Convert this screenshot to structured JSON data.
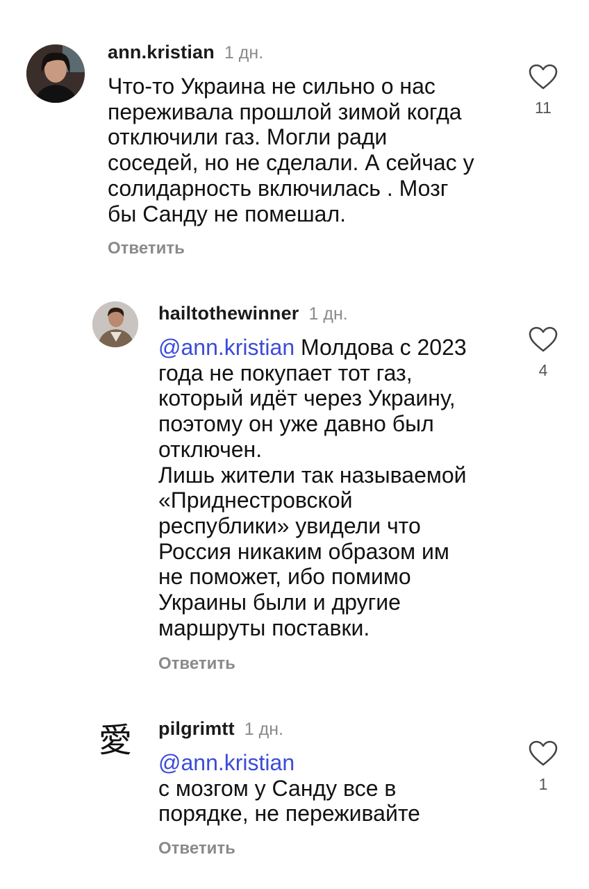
{
  "comments": [
    {
      "username": "ann.kristian",
      "time": "1 дн.",
      "text_lines": [
        "Что-то Украина не сильно о нас",
        "переживала прошлой зимой когда",
        "отключили газ. Могли ради",
        "соседей, но не сделали. А сейчас у",
        "солидарность включилась . Мозг",
        "бы Санду не помешал."
      ],
      "reply_label": "Ответить",
      "likes": "11",
      "like_icon": "heart-outline-icon"
    },
    {
      "username": "hailtothewinner",
      "time": "1 дн.",
      "mention": "@ann.kristian",
      "text_first_rest": " Молдова с 2023",
      "text_lines": [
        "года не покупает тот газ,",
        "который идёт через Украину,",
        "поэтому он уже давно был",
        "отключен.",
        "Лишь жители так называемой",
        "«Приднестровской",
        "республики» увидели что",
        "Россия никаким образом им",
        "не поможет, ибо помимо",
        "Украины были и другие",
        "маршруты поставки."
      ],
      "reply_label": "Ответить",
      "likes": "4",
      "like_icon": "heart-outline-icon"
    },
    {
      "username": "pilgrimtt",
      "time": "1 дн.",
      "mention": "@ann.kristian",
      "text_lines": [
        "с мозгом у Санду все в",
        "порядке, не переживайте"
      ],
      "reply_label": "Ответить",
      "likes": "1",
      "like_icon": "heart-outline-icon",
      "avatar_glyph": "愛"
    }
  ],
  "colors": {
    "mention": "#3b4bd9",
    "muted": "#8a8a8a",
    "text": "#111111"
  }
}
